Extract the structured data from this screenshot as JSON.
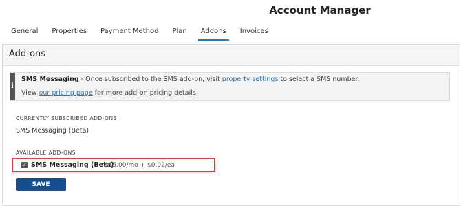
{
  "header": {
    "title": "Account Manager"
  },
  "tabs": [
    {
      "label": "General"
    },
    {
      "label": "Properties"
    },
    {
      "label": "Payment Method"
    },
    {
      "label": "Plan"
    },
    {
      "label": "Addons",
      "active": true
    },
    {
      "label": "Invoices"
    }
  ],
  "panel": {
    "title": "Add-ons",
    "info": {
      "bold": "SMS Messaging",
      "text_before": " - Once subscribed to the SMS add-on, visit ",
      "link1": "property settings",
      "text_after": " to select a SMS number.",
      "line2_before": "View ",
      "link2": "our pricing page",
      "line2_after": " for more add-on pricing details"
    },
    "subscribed_label": "CURRENTLY SUBSCRIBED ADD-ONS",
    "subscribed_item": "SMS Messaging (Beta)",
    "available_label": "AVAILABLE ADD-ONS",
    "available_item": {
      "name": "SMS Messaging (Beta)",
      "price": "$15.00/mo + $0.02/ea",
      "checked": true
    },
    "save_label": "SAVE"
  },
  "colors": {
    "accent": "#1e7ac2",
    "button": "#164f91",
    "highlight": "#e23b3b"
  },
  "icons": {
    "info": "info-icon",
    "checkbox": "checkbox-checked-icon"
  }
}
